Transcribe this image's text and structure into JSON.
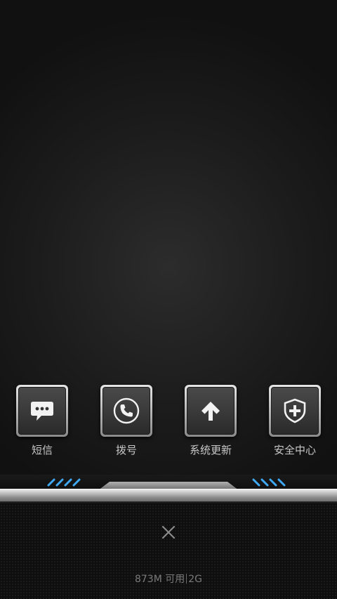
{
  "dock": {
    "apps": [
      {
        "label": "短信",
        "icon": "message-bubble-icon"
      },
      {
        "label": "拨号",
        "icon": "phone-icon"
      },
      {
        "label": "系统更新",
        "icon": "arrow-up-icon"
      },
      {
        "label": "安全中心",
        "icon": "shield-plus-icon"
      }
    ]
  },
  "status": {
    "memory_available": "873M 可用",
    "network": "2G"
  },
  "close": {
    "icon": "close-x-icon"
  },
  "colors": {
    "accent_stripes": "#3fa9f5",
    "label_text": "#c8c8c8",
    "status_text": "#7a7a7a"
  }
}
